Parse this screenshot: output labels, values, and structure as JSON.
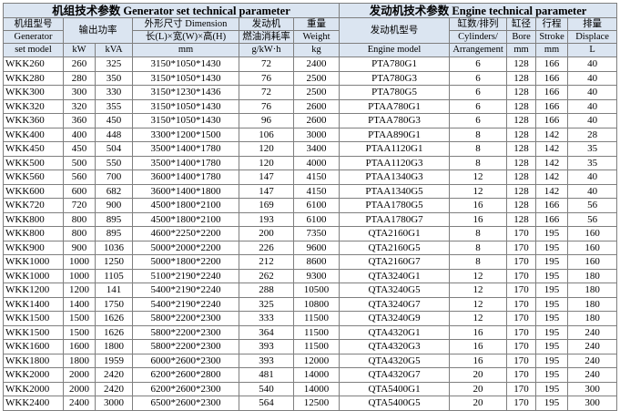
{
  "header": {
    "generator_title": "机组技术参数 Generator set technical parameter",
    "engine_title": "发动机技术参数 Engine technical parameter",
    "model_zh": "机组型号",
    "model_en1": "Generator",
    "model_en2": "set model",
    "power": "输出功率",
    "dimension_zh": "外形尺寸 Dimension",
    "dimension_sub": "长(L)×宽(W)×高(H)",
    "fuel_zh": "发动机",
    "fuel_zh2": "燃油消耗率",
    "weight_zh": "重量",
    "weight_en": "Weight",
    "engine_model_zh": "发动机型号",
    "engine_model_en": "Engine model",
    "cyl_zh": "缸数/排列",
    "cyl_en1": "Cylinders/",
    "cyl_en2": "Arrangement",
    "bore_zh": "缸径",
    "bore_en": "Bore",
    "stroke_zh": "行程",
    "stroke_en": "Stroke",
    "displace_zh": "排量",
    "displace_en": "Displace"
  },
  "units": {
    "kw": "kW",
    "kva": "kVA",
    "mm": "mm",
    "fuel": "g/kW·h",
    "kg": "kg",
    "bore": "mm",
    "stroke": "mm",
    "disp": "L"
  },
  "rows": [
    {
      "model": "WKK260",
      "kw": "260",
      "kva": "325",
      "dim": "3150*1050*1430",
      "fuel": "72",
      "weight": "2400",
      "engine": "PTA780G1",
      "cyl": "6",
      "bore": "128",
      "stroke": "166",
      "disp": "40"
    },
    {
      "model": "WKK280",
      "kw": "280",
      "kva": "350",
      "dim": "3150*1050*1430",
      "fuel": "76",
      "weight": "2500",
      "engine": "PTA780G3",
      "cyl": "6",
      "bore": "128",
      "stroke": "166",
      "disp": "40"
    },
    {
      "model": "WKK300",
      "kw": "300",
      "kva": "330",
      "dim": "3150*1230*1436",
      "fuel": "72",
      "weight": "2500",
      "engine": "PTA780G5",
      "cyl": "6",
      "bore": "128",
      "stroke": "166",
      "disp": "40"
    },
    {
      "model": "WKK320",
      "kw": "320",
      "kva": "355",
      "dim": "3150*1050*1430",
      "fuel": "76",
      "weight": "2600",
      "engine": "PTAA780G1",
      "cyl": "6",
      "bore": "128",
      "stroke": "166",
      "disp": "40"
    },
    {
      "model": "WKK360",
      "kw": "360",
      "kva": "450",
      "dim": "3150*1050*1430",
      "fuel": "96",
      "weight": "2600",
      "engine": "PTAA780G3",
      "cyl": "6",
      "bore": "128",
      "stroke": "166",
      "disp": "40"
    },
    {
      "model": "WKK400",
      "kw": "400",
      "kva": "448",
      "dim": "3300*1200*1500",
      "fuel": "106",
      "weight": "3000",
      "engine": "PTAA890G1",
      "cyl": "8",
      "bore": "128",
      "stroke": "142",
      "disp": "28"
    },
    {
      "model": "WKK450",
      "kw": "450",
      "kva": "504",
      "dim": "3500*1400*1780",
      "fuel": "120",
      "weight": "3400",
      "engine": "PTAA1120G1",
      "cyl": "8",
      "bore": "128",
      "stroke": "142",
      "disp": "35"
    },
    {
      "model": "WKK500",
      "kw": "500",
      "kva": "550",
      "dim": "3500*1400*1780",
      "fuel": "120",
      "weight": "4000",
      "engine": "PTAA1120G3",
      "cyl": "8",
      "bore": "128",
      "stroke": "142",
      "disp": "35"
    },
    {
      "model": "WKK560",
      "kw": "560",
      "kva": "700",
      "dim": "3600*1400*1780",
      "fuel": "147",
      "weight": "4150",
      "engine": "PTAA1340G3",
      "cyl": "12",
      "bore": "128",
      "stroke": "142",
      "disp": "40"
    },
    {
      "model": "WKK600",
      "kw": "600",
      "kva": "682",
      "dim": "3600*1400*1800",
      "fuel": "147",
      "weight": "4150",
      "engine": "PTAA1340G5",
      "cyl": "12",
      "bore": "128",
      "stroke": "142",
      "disp": "40"
    },
    {
      "model": "WKK720",
      "kw": "720",
      "kva": "900",
      "dim": "4500*1800*2100",
      "fuel": "169",
      "weight": "6100",
      "engine": "PTAA1780G5",
      "cyl": "16",
      "bore": "128",
      "stroke": "166",
      "disp": "56"
    },
    {
      "model": "WKK800",
      "kw": "800",
      "kva": "895",
      "dim": "4500*1800*2100",
      "fuel": "193",
      "weight": "6100",
      "engine": "PTAA1780G7",
      "cyl": "16",
      "bore": "128",
      "stroke": "166",
      "disp": "56"
    },
    {
      "model": "WKK800",
      "kw": "800",
      "kva": "895",
      "dim": "4600*2250*2200",
      "fuel": "200",
      "weight": "7350",
      "engine": "QTA2160G1",
      "cyl": "8",
      "bore": "170",
      "stroke": "195",
      "disp": "160"
    },
    {
      "model": "WKK900",
      "kw": "900",
      "kva": "1036",
      "dim": "5000*2000*2200",
      "fuel": "226",
      "weight": "9600",
      "engine": "QTA2160G5",
      "cyl": "8",
      "bore": "170",
      "stroke": "195",
      "disp": "160"
    },
    {
      "model": "WKK1000",
      "kw": "1000",
      "kva": "1250",
      "dim": "5000*1800*2200",
      "fuel": "212",
      "weight": "8600",
      "engine": "QTA2160G7",
      "cyl": "8",
      "bore": "170",
      "stroke": "195",
      "disp": "160"
    },
    {
      "model": "WKK1000",
      "kw": "1000",
      "kva": "1105",
      "dim": "5100*2190*2240",
      "fuel": "262",
      "weight": "9300",
      "engine": "QTA3240G1",
      "cyl": "12",
      "bore": "170",
      "stroke": "195",
      "disp": "180"
    },
    {
      "model": "WKK1200",
      "kw": "1200",
      "kva": "141",
      "dim": "5400*2190*2240",
      "fuel": "288",
      "weight": "10500",
      "engine": "QTA3240G5",
      "cyl": "12",
      "bore": "170",
      "stroke": "195",
      "disp": "180"
    },
    {
      "model": "WKK1400",
      "kw": "1400",
      "kva": "1750",
      "dim": "5400*2190*2240",
      "fuel": "325",
      "weight": "10800",
      "engine": "QTA3240G7",
      "cyl": "12",
      "bore": "170",
      "stroke": "195",
      "disp": "180"
    },
    {
      "model": "WKK1500",
      "kw": "1500",
      "kva": "1626",
      "dim": "5800*2200*2300",
      "fuel": "333",
      "weight": "11500",
      "engine": "QTA3240G9",
      "cyl": "12",
      "bore": "170",
      "stroke": "195",
      "disp": "180"
    },
    {
      "model": "WKK1500",
      "kw": "1500",
      "kva": "1626",
      "dim": "5800*2200*2300",
      "fuel": "364",
      "weight": "11500",
      "engine": "QTA4320G1",
      "cyl": "16",
      "bore": "170",
      "stroke": "195",
      "disp": "240"
    },
    {
      "model": "WKK1600",
      "kw": "1600",
      "kva": "1800",
      "dim": "5800*2200*2300",
      "fuel": "393",
      "weight": "11500",
      "engine": "QTA4320G3",
      "cyl": "16",
      "bore": "170",
      "stroke": "195",
      "disp": "240"
    },
    {
      "model": "WKK1800",
      "kw": "1800",
      "kva": "1959",
      "dim": "6000*2600*2300",
      "fuel": "393",
      "weight": "12000",
      "engine": "QTA4320G5",
      "cyl": "16",
      "bore": "170",
      "stroke": "195",
      "disp": "240"
    },
    {
      "model": "WKK2000",
      "kw": "2000",
      "kva": "2420",
      "dim": "6200*2600*2800",
      "fuel": "481",
      "weight": "14000",
      "engine": "QTA4320G7",
      "cyl": "20",
      "bore": "170",
      "stroke": "195",
      "disp": "240"
    },
    {
      "model": "WKK2000",
      "kw": "2000",
      "kva": "2420",
      "dim": "6200*2600*2300",
      "fuel": "540",
      "weight": "14000",
      "engine": "QTA5400G1",
      "cyl": "20",
      "bore": "170",
      "stroke": "195",
      "disp": "300"
    },
    {
      "model": "WKK2400",
      "kw": "2400",
      "kva": "3000",
      "dim": "6500*2600*2300",
      "fuel": "564",
      "weight": "12500",
      "engine": "QTA5400G5",
      "cyl": "20",
      "bore": "170",
      "stroke": "195",
      "disp": "300"
    }
  ]
}
